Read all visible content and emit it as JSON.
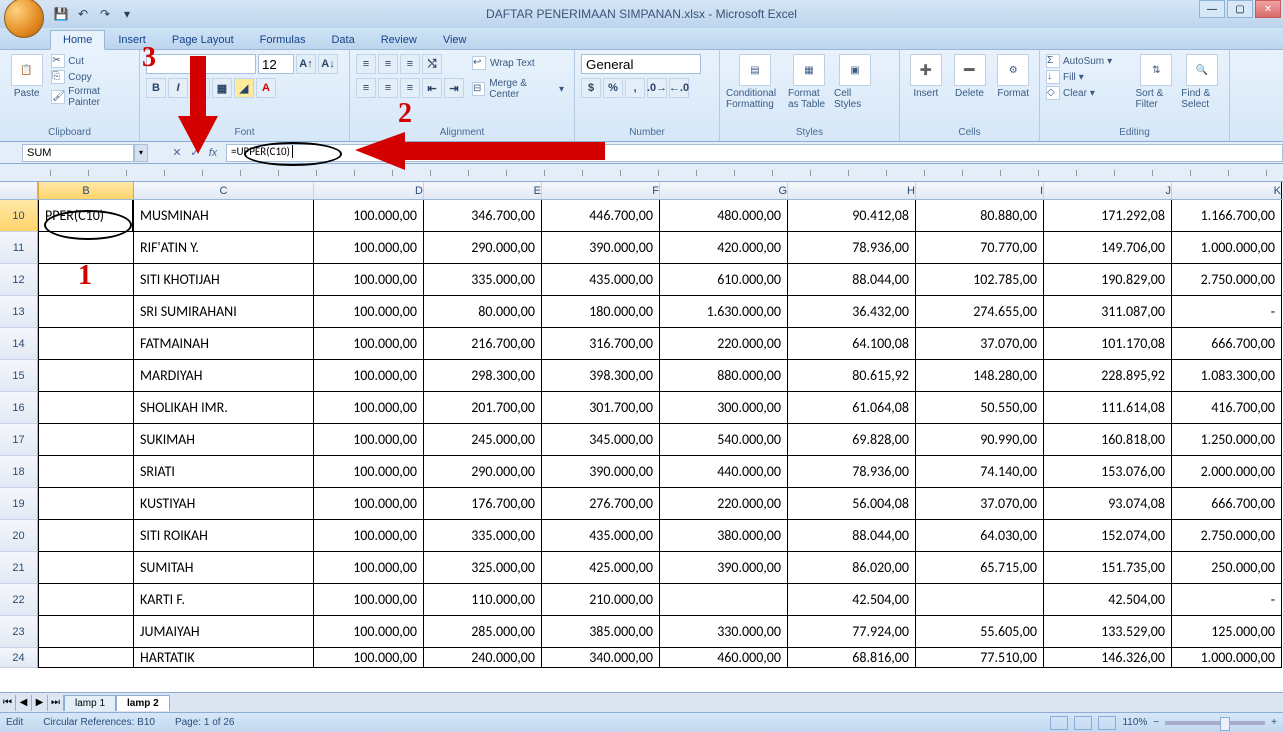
{
  "title": "DAFTAR PENERIMAAN SIMPANAN.xlsx - Microsoft Excel",
  "tabs": [
    "Home",
    "Insert",
    "Page Layout",
    "Formulas",
    "Data",
    "Review",
    "View"
  ],
  "active_tab": 0,
  "name_box": "SUM",
  "formula": "=UPPER(C10)",
  "ribbon": {
    "clipboard": {
      "title": "Clipboard",
      "paste": "Paste",
      "cut": "Cut",
      "copy": "Copy",
      "format_painter": "Format Painter"
    },
    "font": {
      "title": "Font",
      "face": "",
      "size": "12"
    },
    "alignment": {
      "title": "Alignment",
      "wrap": "Wrap Text",
      "merge": "Merge & Center"
    },
    "number": {
      "title": "Number",
      "format": "General"
    },
    "styles": {
      "title": "Styles",
      "cond": "Conditional Formatting",
      "table": "Format as Table",
      "cell": "Cell Styles"
    },
    "cells": {
      "title": "Cells",
      "insert": "Insert",
      "delete": "Delete",
      "format": "Format"
    },
    "editing": {
      "title": "Editing",
      "autosum": "AutoSum",
      "fill": "Fill",
      "clear": "Clear",
      "sort": "Sort & Filter",
      "find": "Find & Select"
    }
  },
  "columns": [
    "B",
    "C",
    "D",
    "E",
    "F",
    "G",
    "H",
    "I",
    "J",
    "K"
  ],
  "col_widths_key": [
    "cB",
    "cC",
    "cD",
    "cE",
    "cF",
    "cG",
    "cH",
    "cI",
    "cJ",
    "cK"
  ],
  "row_start": 10,
  "row_heads": [
    10,
    11,
    12,
    13,
    14,
    15,
    16,
    17,
    18,
    19,
    20,
    21,
    22,
    23,
    24
  ],
  "active_cell_display": "PPER(C10)",
  "table": [
    {
      "C": "MUSMINAH",
      "D": "100.000,00",
      "E": "346.700,00",
      "F": "446.700,00",
      "G": "480.000,00",
      "H": "90.412,08",
      "I": "80.880,00",
      "J": "171.292,08",
      "K": "1.166.700,00"
    },
    {
      "C": "RIF'ATIN Y.",
      "D": "100.000,00",
      "E": "290.000,00",
      "F": "390.000,00",
      "G": "420.000,00",
      "H": "78.936,00",
      "I": "70.770,00",
      "J": "149.706,00",
      "K": "1.000.000,00"
    },
    {
      "C": "SITI KHOTIJAH",
      "D": "100.000,00",
      "E": "335.000,00",
      "F": "435.000,00",
      "G": "610.000,00",
      "H": "88.044,00",
      "I": "102.785,00",
      "J": "190.829,00",
      "K": "2.750.000,00"
    },
    {
      "C": "SRI SUMIRAHANI",
      "D": "100.000,00",
      "E": "80.000,00",
      "F": "180.000,00",
      "G": "1.630.000,00",
      "H": "36.432,00",
      "I": "274.655,00",
      "J": "311.087,00",
      "K": "-"
    },
    {
      "C": "FATMAINAH",
      "D": "100.000,00",
      "E": "216.700,00",
      "F": "316.700,00",
      "G": "220.000,00",
      "H": "64.100,08",
      "I": "37.070,00",
      "J": "101.170,08",
      "K": "666.700,00"
    },
    {
      "C": "MARDIYAH",
      "D": "100.000,00",
      "E": "298.300,00",
      "F": "398.300,00",
      "G": "880.000,00",
      "H": "80.615,92",
      "I": "148.280,00",
      "J": "228.895,92",
      "K": "1.083.300,00"
    },
    {
      "C": "SHOLIKAH IMR.",
      "D": "100.000,00",
      "E": "201.700,00",
      "F": "301.700,00",
      "G": "300.000,00",
      "H": "61.064,08",
      "I": "50.550,00",
      "J": "111.614,08",
      "K": "416.700,00"
    },
    {
      "C": "SUKIMAH",
      "D": "100.000,00",
      "E": "245.000,00",
      "F": "345.000,00",
      "G": "540.000,00",
      "H": "69.828,00",
      "I": "90.990,00",
      "J": "160.818,00",
      "K": "1.250.000,00"
    },
    {
      "C": "SRIATI",
      "D": "100.000,00",
      "E": "290.000,00",
      "F": "390.000,00",
      "G": "440.000,00",
      "H": "78.936,00",
      "I": "74.140,00",
      "J": "153.076,00",
      "K": "2.000.000,00"
    },
    {
      "C": "KUSTIYAH",
      "D": "100.000,00",
      "E": "176.700,00",
      "F": "276.700,00",
      "G": "220.000,00",
      "H": "56.004,08",
      "I": "37.070,00",
      "J": "93.074,08",
      "K": "666.700,00"
    },
    {
      "C": "SITI ROIKAH",
      "D": "100.000,00",
      "E": "335.000,00",
      "F": "435.000,00",
      "G": "380.000,00",
      "H": "88.044,00",
      "I": "64.030,00",
      "J": "152.074,00",
      "K": "2.750.000,00"
    },
    {
      "C": "SUMITAH",
      "D": "100.000,00",
      "E": "325.000,00",
      "F": "425.000,00",
      "G": "390.000,00",
      "H": "86.020,00",
      "I": "65.715,00",
      "J": "151.735,00",
      "K": "250.000,00"
    },
    {
      "C": "KARTI F.",
      "D": "100.000,00",
      "E": "110.000,00",
      "F": "210.000,00",
      "G": "",
      "H": "42.504,00",
      "I": "",
      "J": "42.504,00",
      "K": "-"
    },
    {
      "C": "JUMAIYAH",
      "D": "100.000,00",
      "E": "285.000,00",
      "F": "385.000,00",
      "G": "330.000,00",
      "H": "77.924,00",
      "I": "55.605,00",
      "J": "133.529,00",
      "K": "125.000,00"
    },
    {
      "C": "HARTATIK",
      "D": "100.000,00",
      "E": "240.000,00",
      "F": "340.000,00",
      "G": "460.000,00",
      "H": "68.816,00",
      "I": "77.510,00",
      "J": "146.326,00",
      "K": "1.000.000,00"
    }
  ],
  "sheet_tabs": [
    "lamp 1",
    "lamp 2"
  ],
  "active_sheet": 1,
  "status": {
    "mode": "Edit",
    "circ": "Circular References: B10",
    "page": "Page: 1 of 26",
    "zoom": "110%"
  },
  "annotations": {
    "1": "1",
    "2": "2",
    "3": "3"
  }
}
